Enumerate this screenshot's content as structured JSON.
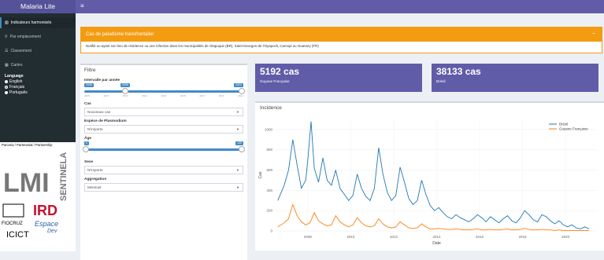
{
  "app": {
    "title": "Malaria Lite"
  },
  "sidebar": {
    "items": [
      {
        "label": "Indicateurs harmonisés",
        "icon": "bar-chart-icon"
      },
      {
        "label": "Par emplacement",
        "icon": "map-marker-icon"
      },
      {
        "label": "Classement",
        "icon": "list-icon"
      },
      {
        "label": "Cartes",
        "icon": "map-icon"
      }
    ],
    "language_title": "Language",
    "languages": [
      "English",
      "Français",
      "Português"
    ],
    "selected_language": "Français",
    "partners_title": "Parceria / Partenariat / Partnership"
  },
  "alert": {
    "title": "Cas de paludisme transfrontalier",
    "body": "Notifié ou ayant son lieu de résidence ou une infection dans les municipalités de Oiapoque (BR), Saint-Georges-de-l'Oyapock, Camopi ou Ouanary (FR)"
  },
  "filter": {
    "title": "Filtre",
    "interval_label": "Intervalle par année",
    "year_range": {
      "min": 2005,
      "max": 2021,
      "from": 2005,
      "to": 2021
    },
    "year_ticks": [
      "2005",
      "2007",
      "2009",
      "2011",
      "2013",
      "2015",
      "2017",
      "2019",
      "2021"
    ],
    "year_tags": [
      "2005",
      "2005",
      "2021"
    ],
    "cas_label": "Cas",
    "cas_value": "Nouveaux cas",
    "espece_label": "Espèce de Plasmodium",
    "espece_value": "N'importe",
    "age_label": "Âge",
    "age_tags": [
      "0",
      "120"
    ],
    "sexe_label": "Sexe",
    "sexe_value": "N'importe",
    "aggregation_label": "Aggregation",
    "aggregation_value": "Mensuel"
  },
  "values": [
    {
      "number": "5192 cas",
      "label": "Guyane Française"
    },
    {
      "number": "38133 cas",
      "label": "Brésil"
    }
  ],
  "chart": {
    "title": "Incidence",
    "xlabel": "Date",
    "ylabel": "Cas"
  },
  "chart_data": {
    "type": "line",
    "title": "Incidence",
    "xlabel": "Date",
    "ylabel": "Cas",
    "ylim": [
      0,
      1100
    ],
    "xlim": [
      2006.5,
      2021.5
    ],
    "x_ticks": [
      "2008",
      "2010",
      "2012",
      "2014",
      "2016",
      "2018",
      "2020"
    ],
    "y_ticks": [
      "0",
      "200",
      "400",
      "600",
      "800",
      "1000"
    ],
    "legend_position": "top-right",
    "series": [
      {
        "name": "Brésil",
        "color": "#1f77b4",
        "points": [
          [
            2006.6,
            300
          ],
          [
            2006.9,
            450
          ],
          [
            2007.1,
            600
          ],
          [
            2007.3,
            900
          ],
          [
            2007.5,
            650
          ],
          [
            2007.7,
            420
          ],
          [
            2007.9,
            500
          ],
          [
            2008.0,
            700
          ],
          [
            2008.15,
            1080
          ],
          [
            2008.3,
            620
          ],
          [
            2008.5,
            480
          ],
          [
            2008.7,
            720
          ],
          [
            2008.9,
            500
          ],
          [
            2009.1,
            450
          ],
          [
            2009.3,
            600
          ],
          [
            2009.5,
            420
          ],
          [
            2009.7,
            360
          ],
          [
            2009.9,
            300
          ],
          [
            2010.1,
            350
          ],
          [
            2010.3,
            560
          ],
          [
            2010.5,
            420
          ],
          [
            2010.7,
            340
          ],
          [
            2010.9,
            300
          ],
          [
            2011.1,
            420
          ],
          [
            2011.3,
            820
          ],
          [
            2011.5,
            560
          ],
          [
            2011.7,
            380
          ],
          [
            2011.9,
            300
          ],
          [
            2012.1,
            350
          ],
          [
            2012.3,
            630
          ],
          [
            2012.5,
            480
          ],
          [
            2012.7,
            320
          ],
          [
            2012.9,
            260
          ],
          [
            2013.1,
            300
          ],
          [
            2013.3,
            500
          ],
          [
            2013.5,
            360
          ],
          [
            2013.7,
            250
          ],
          [
            2013.9,
            200
          ],
          [
            2014.1,
            230
          ],
          [
            2014.3,
            180
          ],
          [
            2014.5,
            140
          ],
          [
            2014.7,
            120
          ],
          [
            2014.9,
            160
          ],
          [
            2015.1,
            130
          ],
          [
            2015.3,
            110
          ],
          [
            2015.5,
            90
          ],
          [
            2015.7,
            120
          ],
          [
            2015.9,
            160
          ],
          [
            2016.1,
            130
          ],
          [
            2016.3,
            90
          ],
          [
            2016.5,
            140
          ],
          [
            2016.7,
            110
          ],
          [
            2016.9,
            80
          ],
          [
            2017.1,
            120
          ],
          [
            2017.3,
            150
          ],
          [
            2017.5,
            100
          ],
          [
            2017.7,
            80
          ],
          [
            2017.9,
            130
          ],
          [
            2018.1,
            200
          ],
          [
            2018.3,
            160
          ],
          [
            2018.5,
            110
          ],
          [
            2018.7,
            90
          ],
          [
            2018.9,
            160
          ],
          [
            2019.1,
            140
          ],
          [
            2019.3,
            100
          ],
          [
            2019.5,
            70
          ],
          [
            2019.7,
            100
          ],
          [
            2019.9,
            60
          ],
          [
            2020.1,
            40
          ],
          [
            2020.3,
            60
          ],
          [
            2020.5,
            30
          ],
          [
            2020.7,
            20
          ],
          [
            2020.9,
            40
          ],
          [
            2021.1,
            20
          ]
        ]
      },
      {
        "name": "Guyane Française",
        "color": "#ff7f0e",
        "points": [
          [
            2006.6,
            40
          ],
          [
            2006.9,
            80
          ],
          [
            2007.1,
            120
          ],
          [
            2007.3,
            260
          ],
          [
            2007.5,
            150
          ],
          [
            2007.7,
            90
          ],
          [
            2007.9,
            60
          ],
          [
            2008.1,
            80
          ],
          [
            2008.3,
            180
          ],
          [
            2008.5,
            100
          ],
          [
            2008.7,
            70
          ],
          [
            2008.9,
            50
          ],
          [
            2009.1,
            60
          ],
          [
            2009.3,
            150
          ],
          [
            2009.5,
            90
          ],
          [
            2009.7,
            60
          ],
          [
            2009.9,
            40
          ],
          [
            2010.1,
            60
          ],
          [
            2010.3,
            130
          ],
          [
            2010.5,
            80
          ],
          [
            2010.7,
            50
          ],
          [
            2010.9,
            40
          ],
          [
            2011.1,
            50
          ],
          [
            2011.3,
            120
          ],
          [
            2011.5,
            70
          ],
          [
            2011.7,
            40
          ],
          [
            2011.9,
            30
          ],
          [
            2012.1,
            40
          ],
          [
            2012.3,
            90
          ],
          [
            2012.5,
            60
          ],
          [
            2012.7,
            30
          ],
          [
            2012.9,
            25
          ],
          [
            2013.1,
            30
          ],
          [
            2013.3,
            70
          ],
          [
            2013.5,
            40
          ],
          [
            2013.7,
            20
          ],
          [
            2013.9,
            20
          ],
          [
            2014.1,
            25
          ],
          [
            2014.3,
            20
          ],
          [
            2014.5,
            15
          ],
          [
            2014.7,
            15
          ],
          [
            2014.9,
            20
          ],
          [
            2015.1,
            15
          ],
          [
            2015.3,
            10
          ],
          [
            2015.5,
            10
          ],
          [
            2015.7,
            15
          ],
          [
            2015.9,
            20
          ],
          [
            2016.1,
            10
          ],
          [
            2016.3,
            10
          ],
          [
            2016.5,
            15
          ],
          [
            2016.7,
            10
          ],
          [
            2016.9,
            10
          ],
          [
            2017.1,
            15
          ],
          [
            2017.3,
            20
          ],
          [
            2017.5,
            10
          ],
          [
            2017.7,
            10
          ],
          [
            2017.9,
            15
          ],
          [
            2018.1,
            25
          ],
          [
            2018.3,
            15
          ],
          [
            2018.5,
            10
          ],
          [
            2018.7,
            10
          ],
          [
            2018.9,
            15
          ],
          [
            2019.1,
            10
          ],
          [
            2019.3,
            10
          ],
          [
            2019.5,
            5
          ],
          [
            2019.7,
            10
          ],
          [
            2019.9,
            5
          ],
          [
            2020.1,
            5
          ],
          [
            2020.3,
            5
          ],
          [
            2020.5,
            5
          ],
          [
            2020.7,
            5
          ],
          [
            2020.9,
            5
          ],
          [
            2021.1,
            5
          ]
        ]
      }
    ]
  }
}
